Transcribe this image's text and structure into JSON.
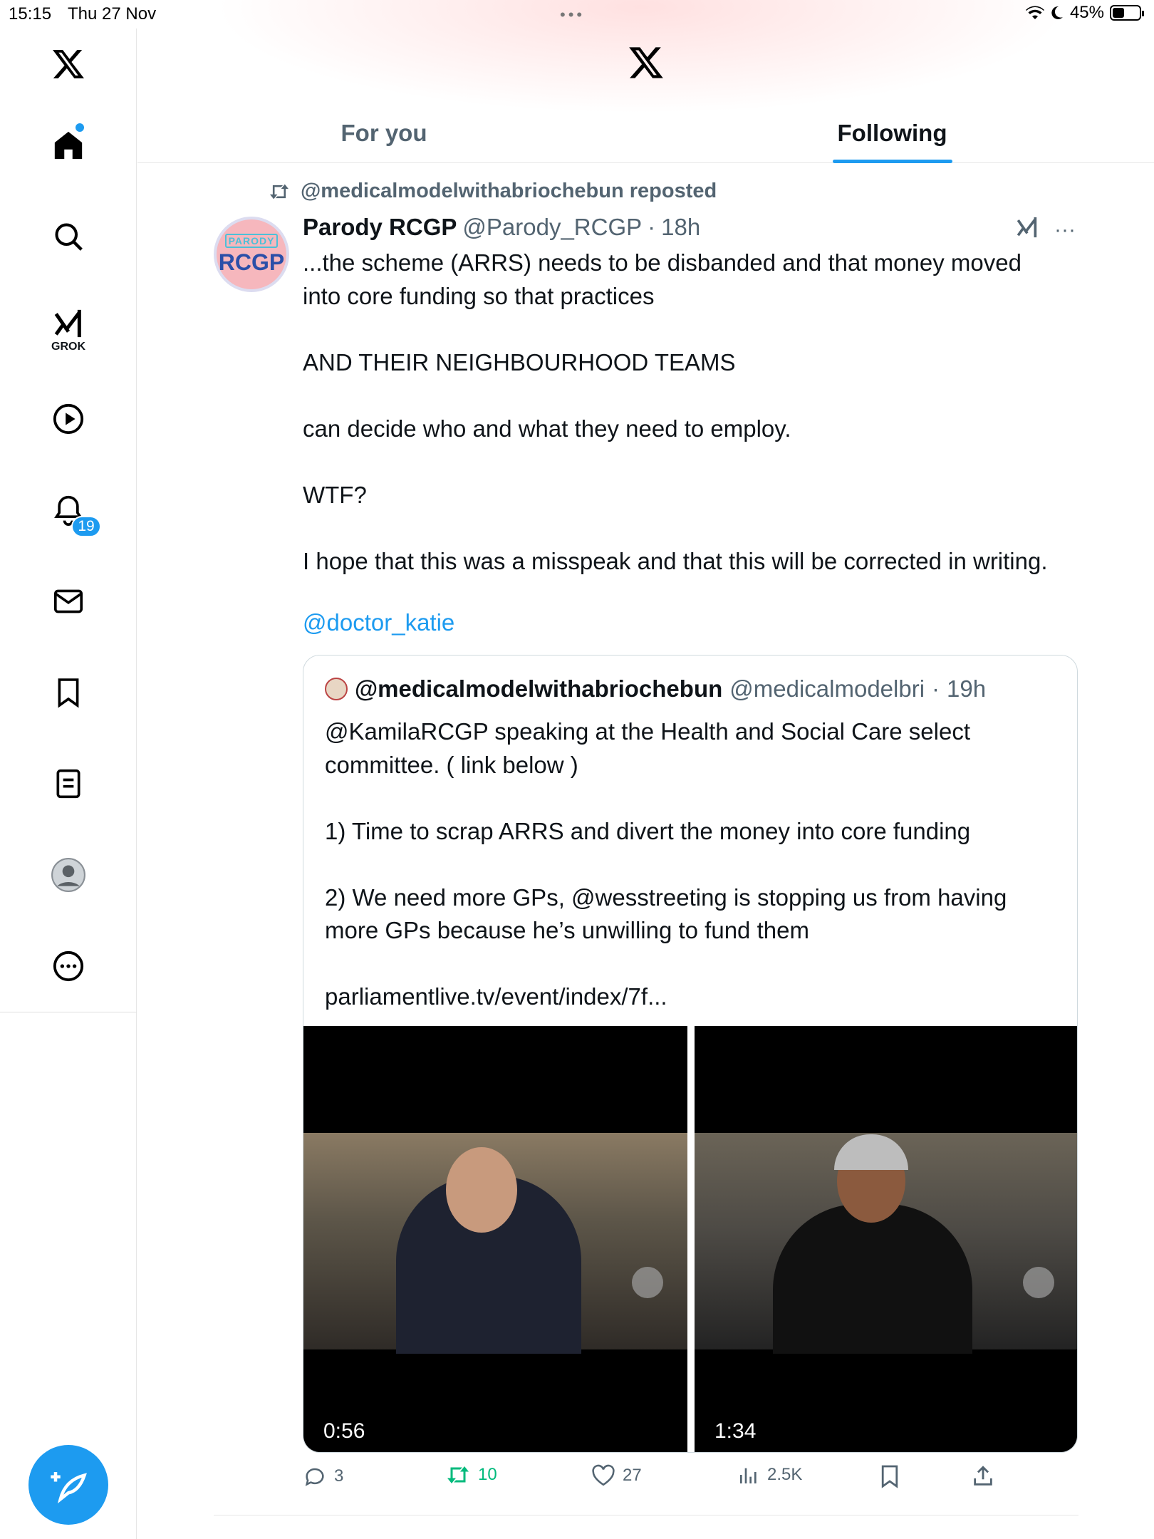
{
  "status_bar": {
    "time": "15:15",
    "date": "Thu 27 Nov",
    "battery": "45%",
    "battery_level": 0.45
  },
  "sidebar": {
    "items": [
      {
        "name": "x-logo",
        "icon": "x-logo-icon"
      },
      {
        "name": "home",
        "icon": "home-icon"
      },
      {
        "name": "search",
        "icon": "search-icon"
      },
      {
        "name": "grok",
        "icon": "grok-icon",
        "label": "GROK"
      },
      {
        "name": "videos",
        "icon": "play-icon"
      },
      {
        "name": "notifications",
        "icon": "bell-icon",
        "badge": "19"
      },
      {
        "name": "messages",
        "icon": "mail-icon"
      },
      {
        "name": "bookmarks",
        "icon": "bookmark-icon"
      },
      {
        "name": "lists",
        "icon": "list-icon"
      },
      {
        "name": "profile",
        "icon": "profile-icon"
      },
      {
        "name": "more",
        "icon": "more-icon"
      }
    ],
    "compose_icon": "compose-icon"
  },
  "header": {
    "tabs": [
      {
        "label": "For you",
        "active": false
      },
      {
        "label": "Following",
        "active": true
      }
    ]
  },
  "tweet": {
    "repost_text": "@medicalmodelwithabriochebun reposted",
    "avatar": {
      "top": "PARODY",
      "main": "RCGP"
    },
    "author_name": "Parody RCGP",
    "author_handle": "@Parody_RCGP",
    "sep": "·",
    "time": "18h",
    "text": "...the scheme (ARRS) needs to be disbanded and that money moved\ninto core funding so that practices\n\nAND THEIR NEIGHBOURHOOD TEAMS\n\ncan decide who and what they need to employ.\n\nWTF?\n\nI hope that this was a misspeak and that this will be corrected in writing.",
    "mention": "@doctor_katie",
    "quote": {
      "author_name": "@medicalmodelwithabriochebun",
      "author_handle": "@medicalmodelbri",
      "sep": "·",
      "time": "19h",
      "text": "@KamilaRCGP speaking at the Health and Social Care select\ncommittee. ( link below )\n\n1) Time to scrap ARRS and divert the money into core funding\n\n2) We need more GPs, @wesstreeting is stopping us from having\nmore GPs because he’s unwilling to fund them\n\nparliamentlive.tv/event/index/7f...",
      "videos": [
        {
          "duration": "0:56"
        },
        {
          "duration": "1:34"
        }
      ]
    },
    "actions": {
      "replies": "3",
      "reposts": "10",
      "likes": "27",
      "views": "2.5K"
    }
  },
  "colors": {
    "accent": "#1d9bf0",
    "repost_green": "#00ba7c",
    "muted": "#536471"
  }
}
